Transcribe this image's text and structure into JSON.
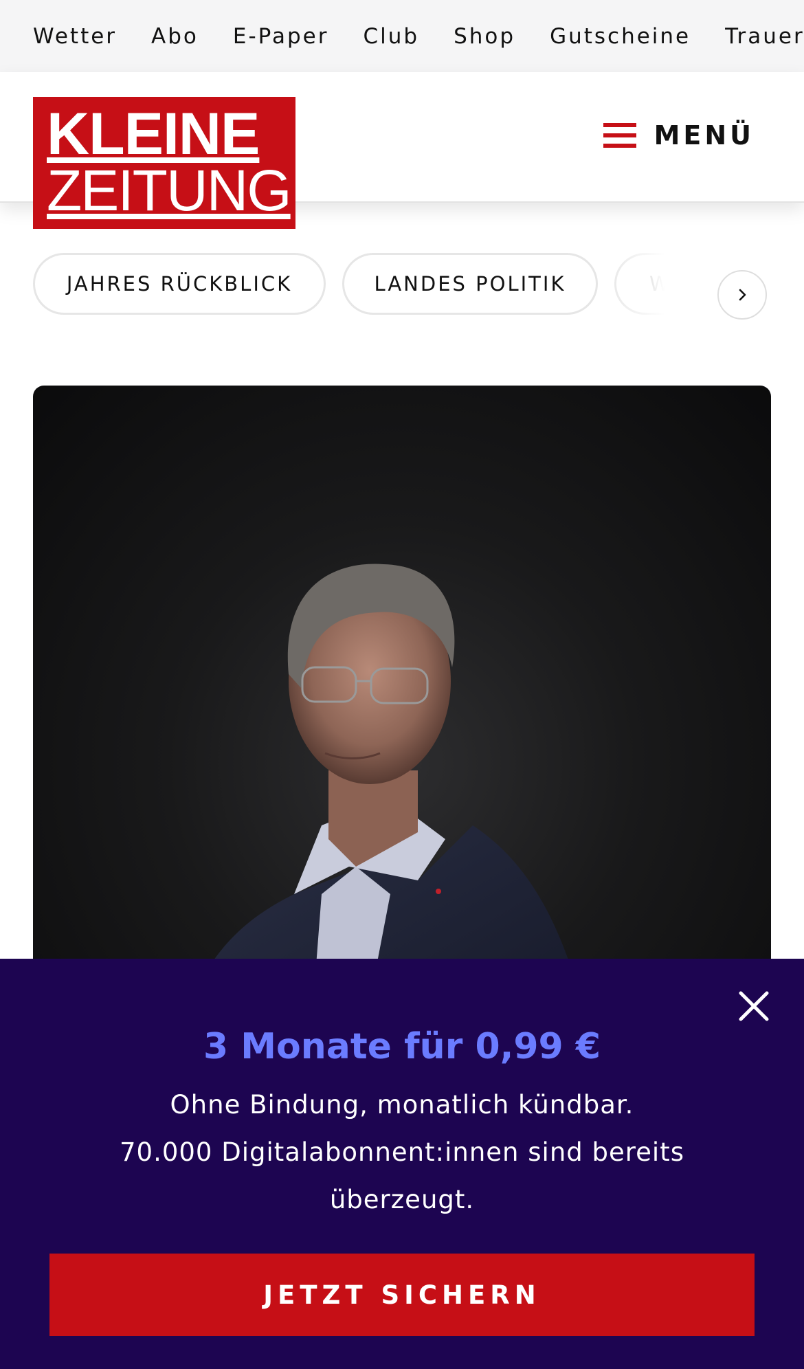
{
  "topnav": {
    "items": [
      {
        "label": "Wetter"
      },
      {
        "label": "Abo"
      },
      {
        "label": "E-Paper"
      },
      {
        "label": "Club"
      },
      {
        "label": "Shop"
      },
      {
        "label": "Gutscheine"
      },
      {
        "label": "Trauerpo"
      }
    ]
  },
  "header": {
    "logo_line1": "KLEINE",
    "logo_line2": "ZEITUNG",
    "menu_label": "MENÜ",
    "menu_icon": "hamburger-icon"
  },
  "categories": {
    "items": [
      {
        "label": "JAHRES RÜCKBLICK"
      },
      {
        "label": "LANDES POLITIK"
      },
      {
        "label": "WE"
      }
    ],
    "next_icon": "chevron-right-icon"
  },
  "paywall": {
    "title": "3 Monate für 0,99 €",
    "text_line1": "Ohne Bindung, monatlich kündbar.",
    "text_line2": "70.000 Digitalabonnent:innen sind bereits überzeugt.",
    "cta_label": "JETZT SICHERN",
    "close_icon": "close-icon"
  },
  "colors": {
    "brand_red": "#c60f16",
    "paywall_bg": "#1d0551",
    "paywall_accent": "#6b7cff"
  }
}
